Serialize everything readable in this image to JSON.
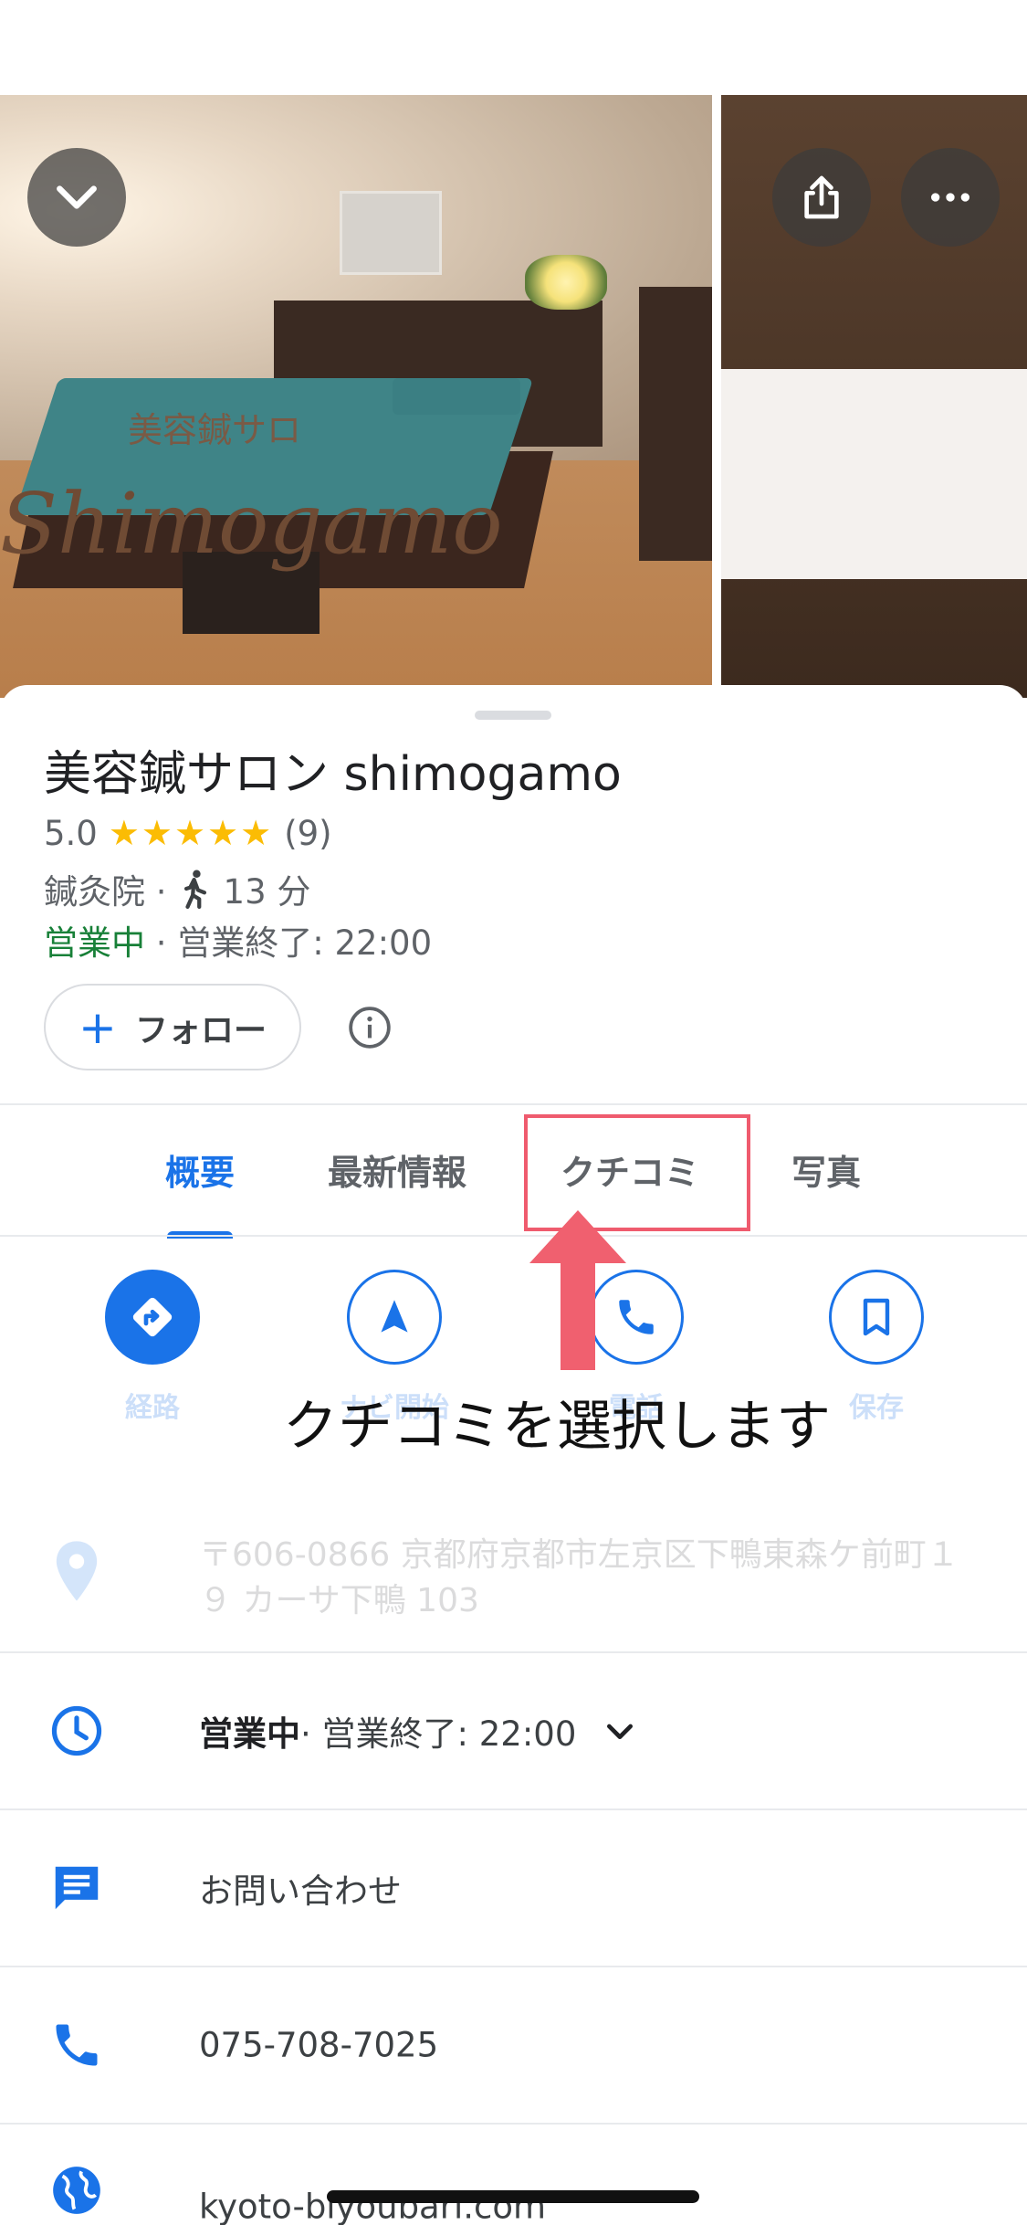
{
  "place": {
    "title": "美容鍼サロン shimogamo",
    "rating": "5.0",
    "stars": "★★★★★",
    "review_count": "(9)",
    "category": "鍼灸院 ·",
    "walk_time": "13 分",
    "status_open": "営業中",
    "closing": " · 営業終了: 22:00"
  },
  "photos": {
    "side_sign_kanji": "美容鍼サロ",
    "side_sign_roman": "Shimogamo"
  },
  "follow": {
    "plus": "+",
    "label": "フォロー"
  },
  "tabs": [
    {
      "label": "概要"
    },
    {
      "label": "最新情報"
    },
    {
      "label": "クチコミ"
    },
    {
      "label": "写真"
    }
  ],
  "actions": [
    {
      "label": "経路"
    },
    {
      "label": "ナビ開始"
    },
    {
      "label": "電話"
    },
    {
      "label": "保存"
    }
  ],
  "annotation": {
    "callout": "クチコミを選択します"
  },
  "address": {
    "text": "〒606-0866 京都府京都市左京区下鴨東森ケ前町１９ カーサ下鴨 103"
  },
  "hours_row": {
    "open": "営業中",
    "closing": " · 営業終了: 22:00"
  },
  "contact": {
    "label": "お問い合わせ"
  },
  "phone": {
    "number": "075-708-7025"
  },
  "website": {
    "url": "kyoto-biyoubari.com"
  },
  "colors": {
    "accent": "#1a73e8",
    "open_green": "#188038",
    "star": "#fbbc04",
    "highlight": "#ef5b6e"
  }
}
